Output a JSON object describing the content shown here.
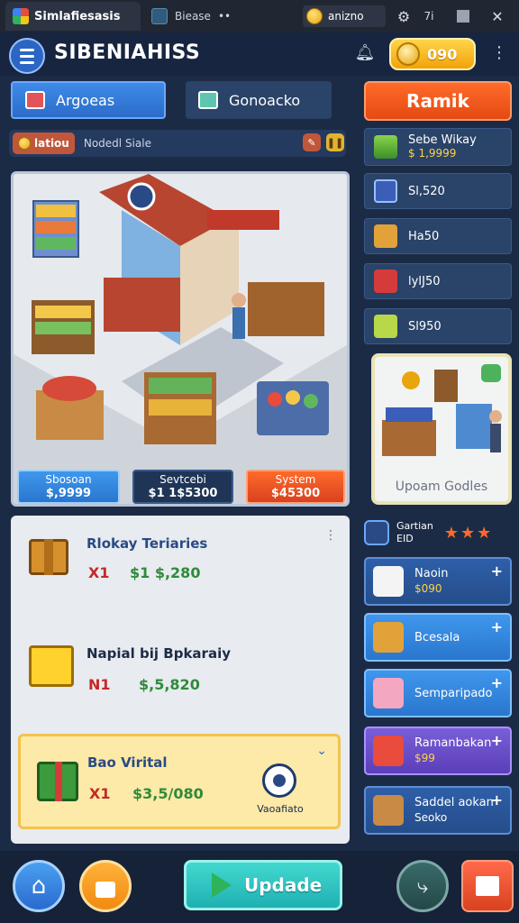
{
  "window": {
    "tab_title": "Simlafiesasis",
    "tab2_title": "Biease",
    "tab2_suffix": "••",
    "coin_label": "anizno",
    "winctl_a": "7i"
  },
  "header": {
    "title": "SIBENIAHISS",
    "gold_value": "090"
  },
  "tabs": {
    "tab1": "Argoeas",
    "tab2": "Gonoacko"
  },
  "rank_button": "Ramik",
  "status": {
    "tag": "latiou",
    "text": "Nodedl Siale"
  },
  "scene": {
    "tags": [
      {
        "name": "Sbosoan",
        "value": "$,9999"
      },
      {
        "name": "Sevtcebi",
        "value": "$1 1$5300"
      },
      {
        "name": "System",
        "value": "$45300"
      }
    ]
  },
  "list_items": [
    {
      "title": "Rlokay Teriaries",
      "qty": "X1",
      "price": "$1 $,280"
    },
    {
      "title": "Napial bij Bpkaraiy",
      "qty": "N1",
      "price": "$,5,820"
    },
    {
      "title": "Bao Virital",
      "qty": "X1",
      "price": "$3,5/080",
      "ring_label": "Vaoafiato"
    }
  ],
  "side_items": [
    {
      "name": "Sebe Wikay",
      "value": "$ 1,9999"
    },
    {
      "name": "Sl,520"
    },
    {
      "name": "Ha50"
    },
    {
      "name": "lyIJ50"
    },
    {
      "name": "Sl950"
    }
  ],
  "upgrade_card": {
    "label": "Upoam Godles"
  },
  "rating_row": {
    "name": "Gartian",
    "value": "EID"
  },
  "blue_cards": [
    {
      "name": "Naoin",
      "value": "$090"
    },
    {
      "name": "Bcesala"
    },
    {
      "name": "Semparipado"
    },
    {
      "name": "Ramanbakan",
      "value": "$99"
    },
    {
      "name": "Saddel aokan",
      "value": "Seoko"
    }
  ],
  "bottom": {
    "update": "Updade"
  },
  "colors": {
    "accent": "#ff6a2a",
    "primary": "#2c66c4",
    "gold": "#ffd34a",
    "bg": "#1c2b45"
  }
}
